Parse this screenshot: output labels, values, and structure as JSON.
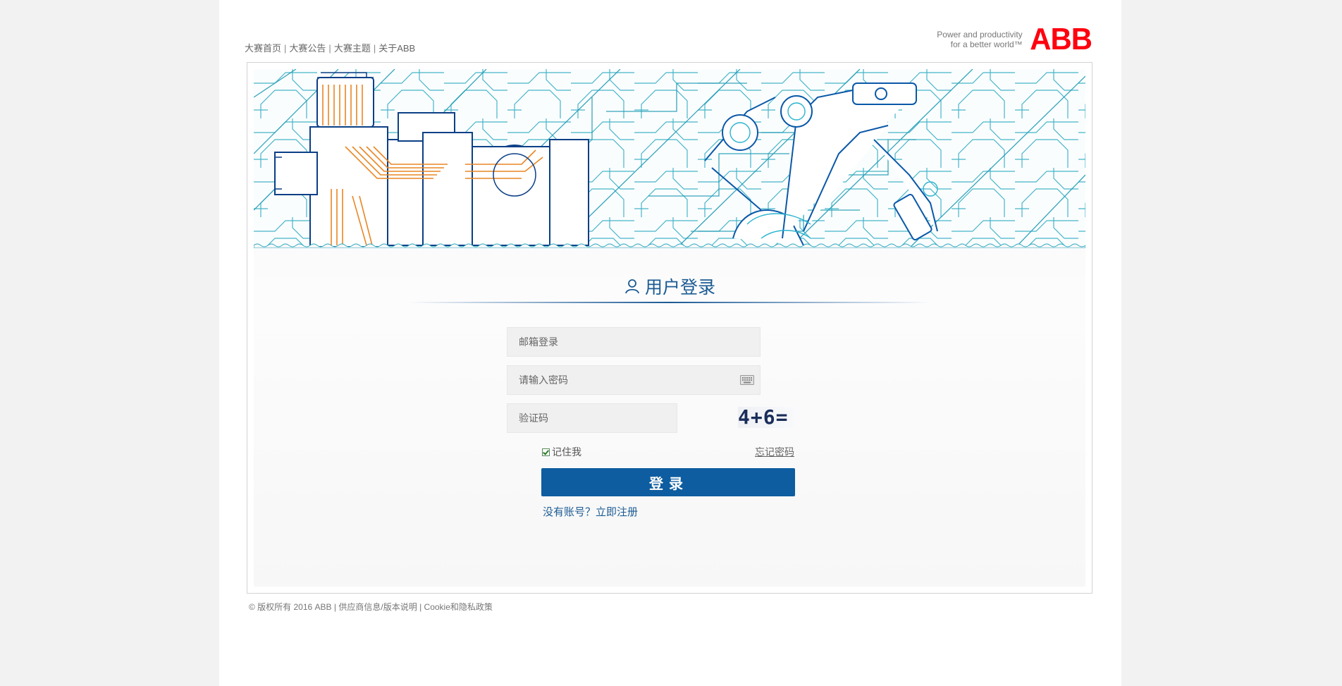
{
  "nav": {
    "items": [
      "大赛首页",
      "大赛公告",
      "大赛主题",
      "关于ABB"
    ],
    "separator": "|"
  },
  "brand": {
    "tagline_line1": "Power and productivity",
    "tagline_line2": "for a better world™",
    "logo_text": "ABB",
    "logo_color": "#ff000f"
  },
  "login": {
    "title": "用户登录",
    "email_placeholder": "邮箱登录",
    "password_placeholder": "请输入密码",
    "captcha_placeholder": "验证码",
    "captcha_image_text": "4+6=",
    "remember_label": "记住我",
    "remember_checked": true,
    "forgot_label": "忘记密码",
    "submit_label": "登录",
    "register_link": "没有账号？立即注册"
  },
  "footer": {
    "copyright": "© 版权所有 2016 ABB",
    "links": [
      "供应商信息/版本说明",
      "Cookie和隐私政策"
    ],
    "separator": "|"
  },
  "colors": {
    "accent": "#0d5da0",
    "title_blue": "#1c5b93",
    "brand_red": "#ff000f",
    "banner_teal": "#1aa0b8",
    "banner_orange": "#f08a1e"
  },
  "icons": {
    "title_icon": "user-icon",
    "password_field_icon": "keyboard-icon"
  }
}
